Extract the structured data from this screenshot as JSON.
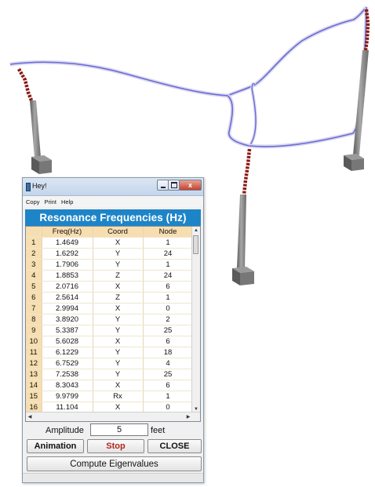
{
  "window": {
    "title": "Hey!",
    "close_glyph": "x",
    "menu": [
      "Copy",
      "Print",
      "Help"
    ]
  },
  "table": {
    "heading": "Resonance Frequencies (Hz)",
    "columns": [
      "",
      "Freq(Hz)",
      "Coord",
      "Node"
    ],
    "rows": [
      [
        "1",
        "1.4649",
        "X",
        "1"
      ],
      [
        "2",
        "1.6292",
        "Y",
        "24"
      ],
      [
        "3",
        "1.7906",
        "Y",
        "1"
      ],
      [
        "4",
        "1.8853",
        "Z",
        "24"
      ],
      [
        "5",
        "2.0716",
        "X",
        "6"
      ],
      [
        "6",
        "2.5614",
        "Z",
        "1"
      ],
      [
        "7",
        "2.9994",
        "X",
        "0"
      ],
      [
        "8",
        "3.8920",
        "Y",
        "2"
      ],
      [
        "9",
        "5.3387",
        "Y",
        "25"
      ],
      [
        "10",
        "5.6028",
        "X",
        "6"
      ],
      [
        "11",
        "6.1229",
        "Y",
        "18"
      ],
      [
        "12",
        "6.7529",
        "Y",
        "4"
      ],
      [
        "13",
        "7.2538",
        "Y",
        "25"
      ],
      [
        "14",
        "8.3043",
        "X",
        "6"
      ],
      [
        "15",
        "9.9799",
        "Rx",
        "1"
      ],
      [
        "16",
        "11.104",
        "X",
        "0"
      ]
    ]
  },
  "amplitude": {
    "label": "Amplitude",
    "value": "5",
    "unit": "feet"
  },
  "buttons": {
    "animation": "Animation",
    "stop": "Stop",
    "close": "CLOSE",
    "compute": "Compute Eigenvalues"
  },
  "colors": {
    "heading_bg": "#1e84c8",
    "cell_header_bg": "#f7deb0",
    "stop_text": "#b0281c",
    "cable": "#6a6ad8",
    "insulator": "#8b1a14",
    "pole": "#7f7f7f"
  },
  "icons": {
    "minimize": "minimize-icon",
    "maximize": "maximize-icon",
    "close": "close-icon",
    "scroll_up": "arrow-up-icon",
    "scroll_down": "arrow-down-icon",
    "scroll_left": "arrow-left-icon",
    "scroll_right": "arrow-right-icon"
  }
}
